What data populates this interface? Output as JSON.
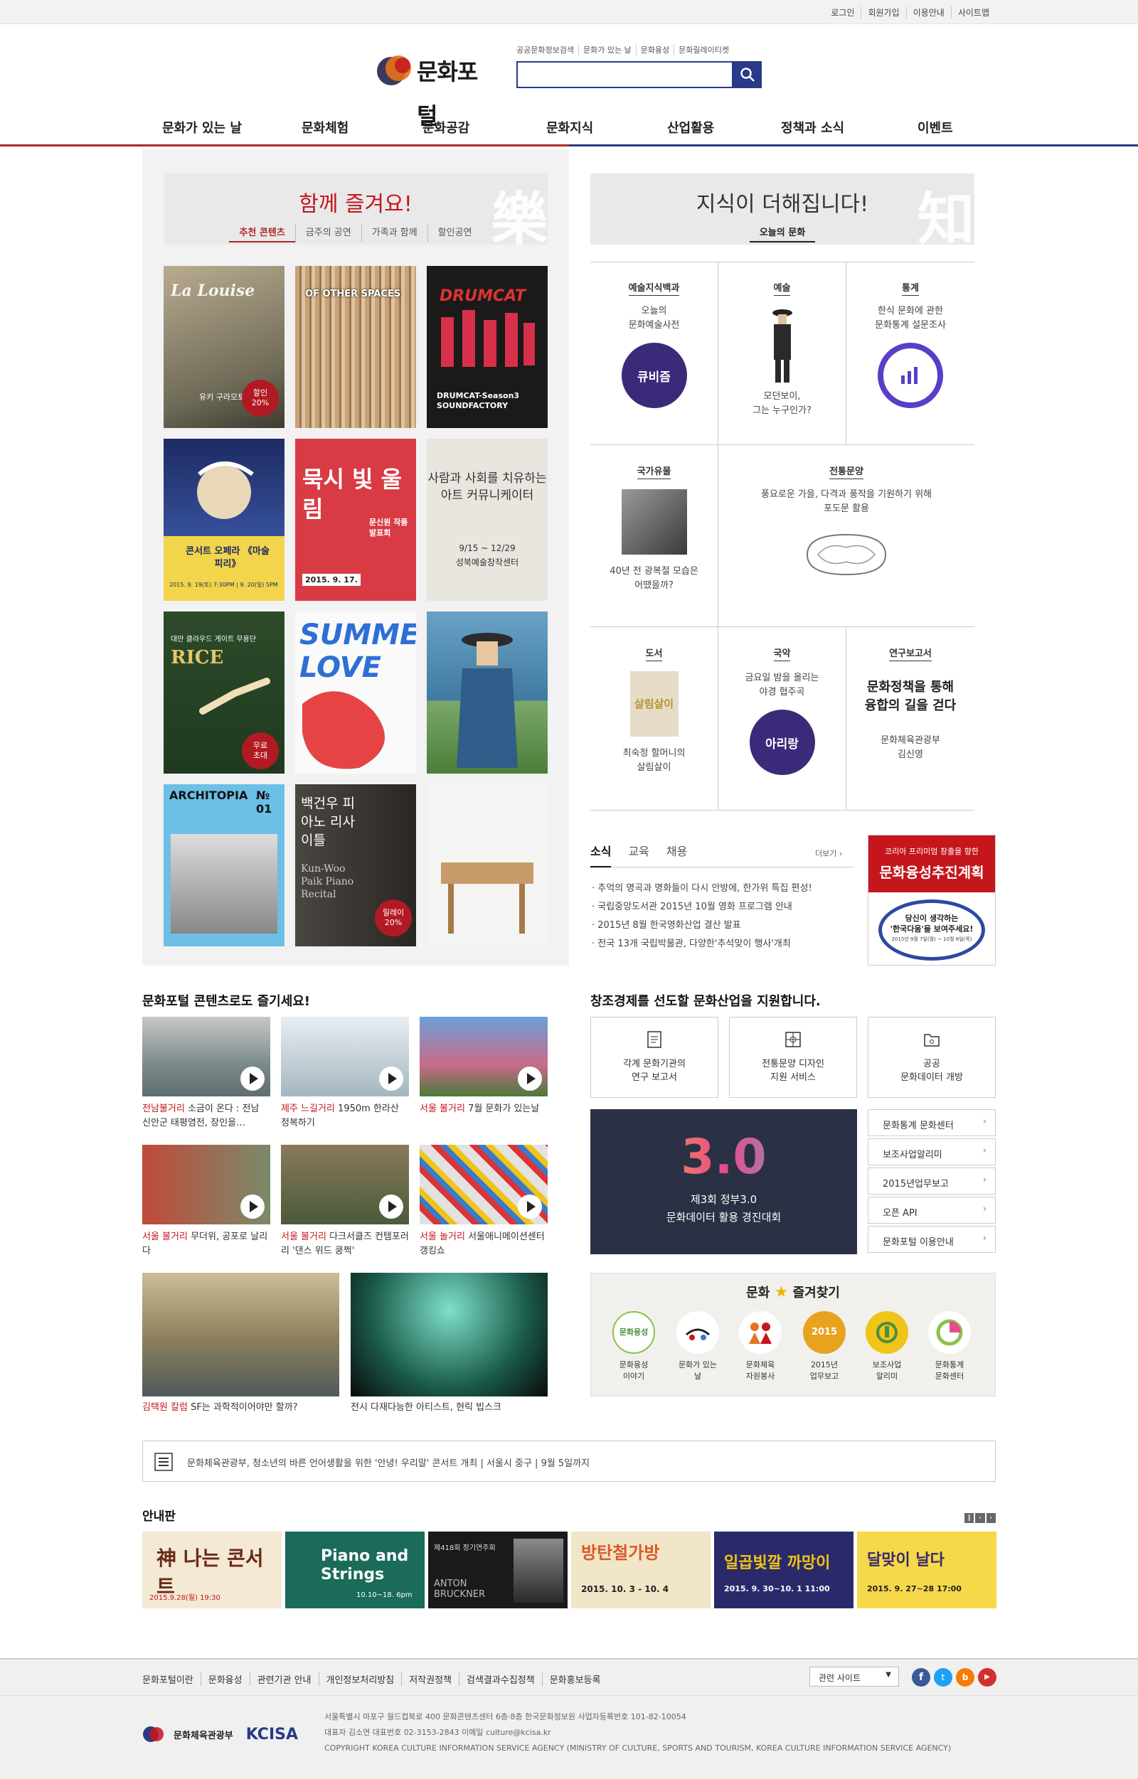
{
  "util_links": [
    "로그인",
    "회원가입",
    "이용안내",
    "사이트맵"
  ],
  "logo": {
    "text": "문화포털"
  },
  "quick_links": [
    "공공문화정보검색",
    "문화가 있는 날",
    "문화융성",
    "문화릴레이티켓"
  ],
  "search": {
    "placeholder": "",
    "icon": "search-icon"
  },
  "gnb": [
    "문화가 있는 날",
    "문화체험",
    "문화공감",
    "문화지식",
    "산업활용",
    "정책과 소식",
    "이벤트"
  ],
  "enjoy": {
    "title": "함께 즐겨요!",
    "hanja": "樂",
    "tabs": [
      "추천 콘텐츠",
      "금주의 공연",
      "가족과 함께",
      "할인공연"
    ],
    "posters": [
      {
        "title": "La Louise",
        "sub": "유키 구라모토",
        "badge": "할인\n20%"
      },
      {
        "title": "OF OTHER SPACES",
        "sub": ""
      },
      {
        "title": "DRUMCAT",
        "sub": "DRUMCAT-Season3\nSOUNDFACTORY"
      },
      {
        "title": "콘서트 오페라 《마술피리》",
        "sub": "2015. 9. 19(토) 7:30PM | 9. 20(일) 5PM"
      },
      {
        "title": "묵시 빛 울림",
        "sub": "문신원 작품 발표회",
        "date": "2015. 9. 17."
      },
      {
        "title": "사람과 사회를 치유하는 아트 커뮤니케이터",
        "sub": "9/15 ~ 12/29\n성북예술창작센터"
      },
      {
        "title": "RICE",
        "sub": "대만 클라우드 게이트 무용단",
        "badge": "무료\n초대"
      },
      {
        "title": "SUMMER LOVE",
        "sub": ""
      },
      {
        "title": "",
        "sub": ""
      },
      {
        "title": "ARCHITOPIA",
        "sub": "№ 01"
      },
      {
        "title": "백건우 피아노 리사이틀",
        "sub": "Kun-Woo Paik Piano Recital",
        "badge": "릴레이\n20%"
      },
      {
        "title": "",
        "sub": ""
      }
    ]
  },
  "knowledge": {
    "title": "지식이 더해집니다!",
    "hanja": "知",
    "tab": "오늘의 문화",
    "cells": [
      {
        "cat": "예술지식백과",
        "text": "오늘의\n문화예술사전",
        "circle": "큐비즘"
      },
      {
        "cat": "예술",
        "text": "모던보이,\n그는 누구인가?"
      },
      {
        "cat": "통계",
        "text": "한식 문화에 관한\n문화통계 설문조사"
      },
      {
        "cat": "국가유물",
        "text": "40년 전 광복절 모습은\n어땠을까?"
      },
      {
        "cat": "전통문양",
        "text": "풍요로운 가을, 다격과 풍작을 기원하기 위해\n포도문 활용"
      },
      {
        "cat": "도서",
        "text": "최숙정 할머니의\n살림살이",
        "book": "살림살이"
      },
      {
        "cat": "국악",
        "text": "금요일 밤을 올리는\n야경 협주곡",
        "circle": "아리랑"
      },
      {
        "cat": "연구보고서",
        "big": "문화정책을 통해\n융합의 길을 걷다",
        "text": "문화체육관광부\n김신영"
      }
    ]
  },
  "news": {
    "tabs": [
      "소식",
      "교육",
      "채용"
    ],
    "more": "더보기",
    "items": [
      "추억의 명곡과 명화들이 다시 안방에, 한가위 특집 편성!",
      "국립중앙도서관 2015년 10월 영화 프로그램 안내",
      "2015년 8월 한국영화산업 결산 발표",
      "전국 13개 국립박물관, 다양한'추석맞이 행사'개최"
    ],
    "promo": {
      "top": "코리아 프리미엄 창출을 향한",
      "title": "문화융성추진계획",
      "sub": "당신이 생각하는\n'한국다움'을 보여주세요!",
      "date": "2015년 9월 7일(월) ~ 10월 8일(목)"
    }
  },
  "contents": {
    "title": "문화포털 콘텐츠로도 즐기세요!",
    "videos": [
      {
        "tag": "전남불거리",
        "cap": "소금이 온다 : 전남 신안군 태평염전, 장인을…"
      },
      {
        "tag": "제주 느길거리",
        "cap": "1950m 한라산 정복하기"
      },
      {
        "tag": "서울 볼거리",
        "cap": "7월 문화가 있는날"
      },
      {
        "tag": "서울 볼거리",
        "cap": "무더위, 공포로 날리다"
      },
      {
        "tag": "서울 볼거리",
        "cap": "다크서클즈 컨템포러리 '댄스 위드 쿵쩍'"
      },
      {
        "tag": "서울 놀거리",
        "cap": "서울애니메이션센터 갱킹쇼"
      }
    ],
    "wide": [
      {
        "tag": "김택원 칼럼",
        "cap": "SF는 과학적이어야만 할까?"
      },
      {
        "tag": "",
        "cap": "전시 다재다능한 아티스트, 현릭 빕스크"
      }
    ]
  },
  "industry": {
    "title": "창조경제를 선도할 문화산업을 지원합니다.",
    "boxes": [
      "각계 문화기관의\n연구 보고서",
      "전통문양 디자인\n지원 서비스",
      "공공\n문화데이터 개방"
    ],
    "contest": {
      "big": "3.0",
      "line1": "제3회 정부3.0",
      "line2": "문화데이터 활용 경진대회"
    },
    "links": [
      "문화통계 문화센터",
      "보조사업알리미",
      "2015년업무보고",
      "오픈 API",
      "문화포털 이용안내"
    ]
  },
  "favorites": {
    "title_a": "문화",
    "title_b": "즐겨찾기",
    "items": [
      {
        "label": "문화융성\n이야기",
        "icon": "문화융성",
        "color": "#f4f4f4",
        "fg": "#4a8f3f"
      },
      {
        "label": "문화가 있는 날",
        "icon": "",
        "color": "#f4f4f4",
        "fg": "#c4161c"
      },
      {
        "label": "문화체육\n자원봉사",
        "icon": "",
        "color": "#f4f4f4",
        "fg": "#e4731d"
      },
      {
        "label": "2015년\n업무보고",
        "icon": "2015",
        "color": "#e8a31e",
        "fg": "#fff"
      },
      {
        "label": "보조사업\n알리미",
        "icon": "",
        "color": "#f0c419",
        "fg": "#4a8f3f"
      },
      {
        "label": "문화통계\n문화센터",
        "icon": "",
        "color": "#f4f4f4",
        "fg": "#c4161c"
      }
    ]
  },
  "notice": "문화체육관광부, 청소년의 바른 언어생활을 위한 '안녕! 우리말' 콘서트 개최 | 서울시 중구 | 9월 5일까지",
  "board": {
    "title": "안내판",
    "items": [
      {
        "t": "神 나는 콘서트",
        "d": "2015.9.28(월) 19:30"
      },
      {
        "t": "Piano and Strings",
        "d": "10.10~18. 6pm"
      },
      {
        "t": "ANTON BRUCKNER",
        "d": "제418회 정기연주회"
      },
      {
        "t": "방탄철가방",
        "d": "2015. 10. 3 - 10. 4"
      },
      {
        "t": "일곱빛깔 까망이",
        "d": "2015. 9. 30~10. 1 11:00"
      },
      {
        "t": "달맞이 날다",
        "d": "2015. 9. 27~28 17:00"
      }
    ]
  },
  "footer": {
    "nav": [
      "문화포털이란",
      "문화융성",
      "관련기관 안내",
      "개인정보처리방침",
      "저작권정책",
      "검색결과수집정책",
      "문화홍보등록"
    ],
    "related": "관련 사이트",
    "org1": "문화체육관광부",
    "org2": "KCISA",
    "addr": "서울특별시 마포구 월드컵북로 400 문화콘텐츠센터 6층·8층 한국문화정보원 사업자등록번호 101-82-10054",
    "ceo": "대표자 김소연 대표번호 02-3153-2843 이메일 culture@kcisa.kr",
    "copy": "COPYRIGHT KOREA CULTURE INFORMATION SERVICE AGENCY (MINISTRY OF CULTURE, SPORTS AND TOURISM, KOREA CULTURE INFORMATION SERVICE AGENCY)"
  },
  "colors": {
    "brand_blue": "#283a88",
    "brand_red": "#b1262b",
    "purple": "#3b2a7a"
  }
}
